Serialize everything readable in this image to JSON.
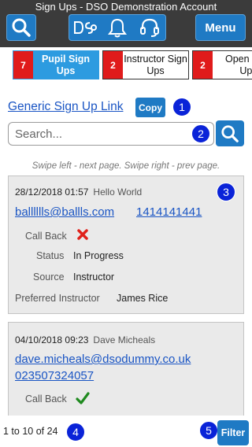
{
  "header": {
    "title": "Sign Ups - DSO Demonstration Account",
    "logo_text": "DSO",
    "menu_label": "Menu"
  },
  "tabs": [
    {
      "count": "7",
      "label": "Pupil Sign Ups",
      "active": true
    },
    {
      "count": "2",
      "label": "Instructor Sign Ups",
      "active": false
    },
    {
      "count": "2",
      "label": "Open Fo... Ups",
      "active": false
    }
  ],
  "generic_link": {
    "label": "Generic Sign Up Link",
    "copy_label": "Copy"
  },
  "search": {
    "placeholder": "Search..."
  },
  "hint": "Swipe left - next page. Swipe right - prev page.",
  "badges": [
    "1",
    "2",
    "3",
    "4",
    "5"
  ],
  "cards": [
    {
      "datetime": "28/12/2018 01:57",
      "name": "Hello World",
      "email": "balllllls@ballls.com",
      "phone": "1414141441",
      "callback_label": "Call Back",
      "callback_state": "no",
      "status_label": "Status",
      "status_value": "In Progress",
      "source_label": "Source",
      "source_value": "Instructor",
      "pref_label": "Preferred Instructor",
      "pref_value": "James Rice"
    },
    {
      "datetime": "04/10/2018 09:23",
      "name": "Dave Micheals",
      "email": "dave.micheals@dsodummy.co.uk",
      "phone": "023507324057",
      "callback_label": "Call Back",
      "callback_state": "yes"
    }
  ],
  "footer": {
    "pager": "1 to 10 of 24",
    "filter_label": "Filter"
  },
  "colors": {
    "header_bg": "#3b3b3b",
    "button_blue": "#1f7ac4",
    "active_tab": "#2d9be0",
    "count_red": "#e01b1b",
    "badge_blue": "#0a23d8",
    "link_blue": "#1a55c4",
    "cross_red": "#e0211a",
    "check_green": "#1f8a1f"
  },
  "icons": [
    "search-icon",
    "dso-logo-icon",
    "bell-icon",
    "headset-icon",
    "cross-icon",
    "check-icon"
  ]
}
